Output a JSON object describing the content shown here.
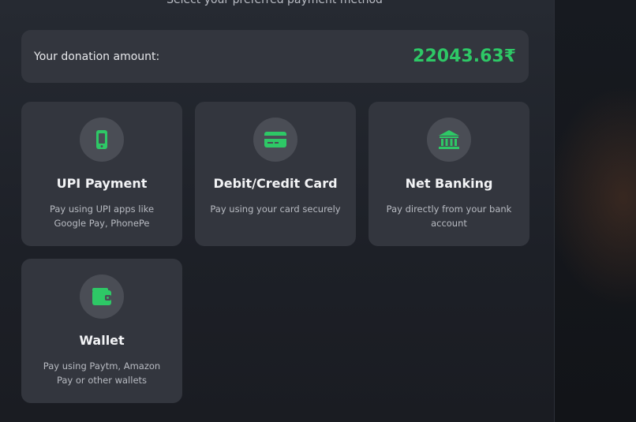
{
  "header": {
    "subtitle": "Select your preferred payment method"
  },
  "donation": {
    "label": "Your donation amount:",
    "amount": "22043.63₹"
  },
  "methods": [
    {
      "title": "UPI Payment",
      "description": "Pay using UPI apps like Google Pay, PhonePe",
      "icon": "mobile-phone-icon"
    },
    {
      "title": "Debit/Credit Card",
      "description": "Pay using your card securely",
      "icon": "credit-card-icon"
    },
    {
      "title": "Net Banking",
      "description": "Pay directly from your bank account",
      "icon": "bank-icon"
    },
    {
      "title": "Wallet",
      "description": "Pay using Paytm, Amazon Pay or other wallets",
      "icon": "wallet-icon"
    }
  ],
  "colors": {
    "accent": "#2ec866",
    "card": "#33363e",
    "icon_bg": "#4a4d55"
  }
}
